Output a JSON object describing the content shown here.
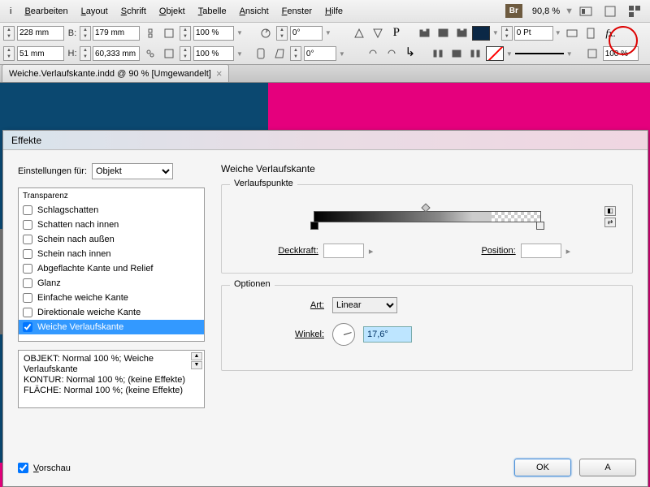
{
  "menu": {
    "items": [
      "i",
      "Bearbeiten",
      "Layout",
      "Schrift",
      "Objekt",
      "Tabelle",
      "Ansicht",
      "Fenster",
      "Hilfe"
    ],
    "br": "Br",
    "zoom": "90,8 %"
  },
  "toolbar": {
    "x": {
      "label": "",
      "value": "228 mm"
    },
    "b": {
      "label": "B:",
      "value": "179 mm"
    },
    "y": {
      "label": "",
      "value": "51 mm"
    },
    "h": {
      "label": "H:",
      "value": "60,333 mm"
    },
    "scaleX": "100 %",
    "scaleY": "100 %",
    "rotate": "0°",
    "shear": "0°",
    "stroke": "0 Pt",
    "opacity": "100 %"
  },
  "tab": {
    "title": "Weiche.Verlaufskante.indd @ 90 % [Umgewandelt]"
  },
  "dialog": {
    "title": "Effekte",
    "settingsLabel": "Einstellungen für:",
    "settingsTarget": "Objekt",
    "effects": [
      "Transparenz",
      "Schlagschatten",
      "Schatten nach innen",
      "Schein nach außen",
      "Schein nach innen",
      "Abgeflachte Kante und Relief",
      "Glanz",
      "Einfache weiche Kante",
      "Direktionale weiche Kante",
      "Weiche Verlaufskante"
    ],
    "summary": {
      "l1": "OBJEKT: Normal 100 %; Weiche Verlaufskante",
      "l2": "KONTUR: Normal 100 %; (keine Effekte)",
      "l3": "FLÄCHE: Normal 100 %; (keine Effekte)"
    },
    "preview": "Vorschau",
    "panelTitle": "Weiche Verlaufskante",
    "group1": "Verlaufspunkte",
    "opacityLabel": "Deckkraft:",
    "positionLabel": "Position:",
    "group2": "Optionen",
    "artLabel": "Art:",
    "artValue": "Linear",
    "angleLabel": "Winkel:",
    "angleValue": "17,6°",
    "ok": "OK",
    "cancel": "A"
  }
}
